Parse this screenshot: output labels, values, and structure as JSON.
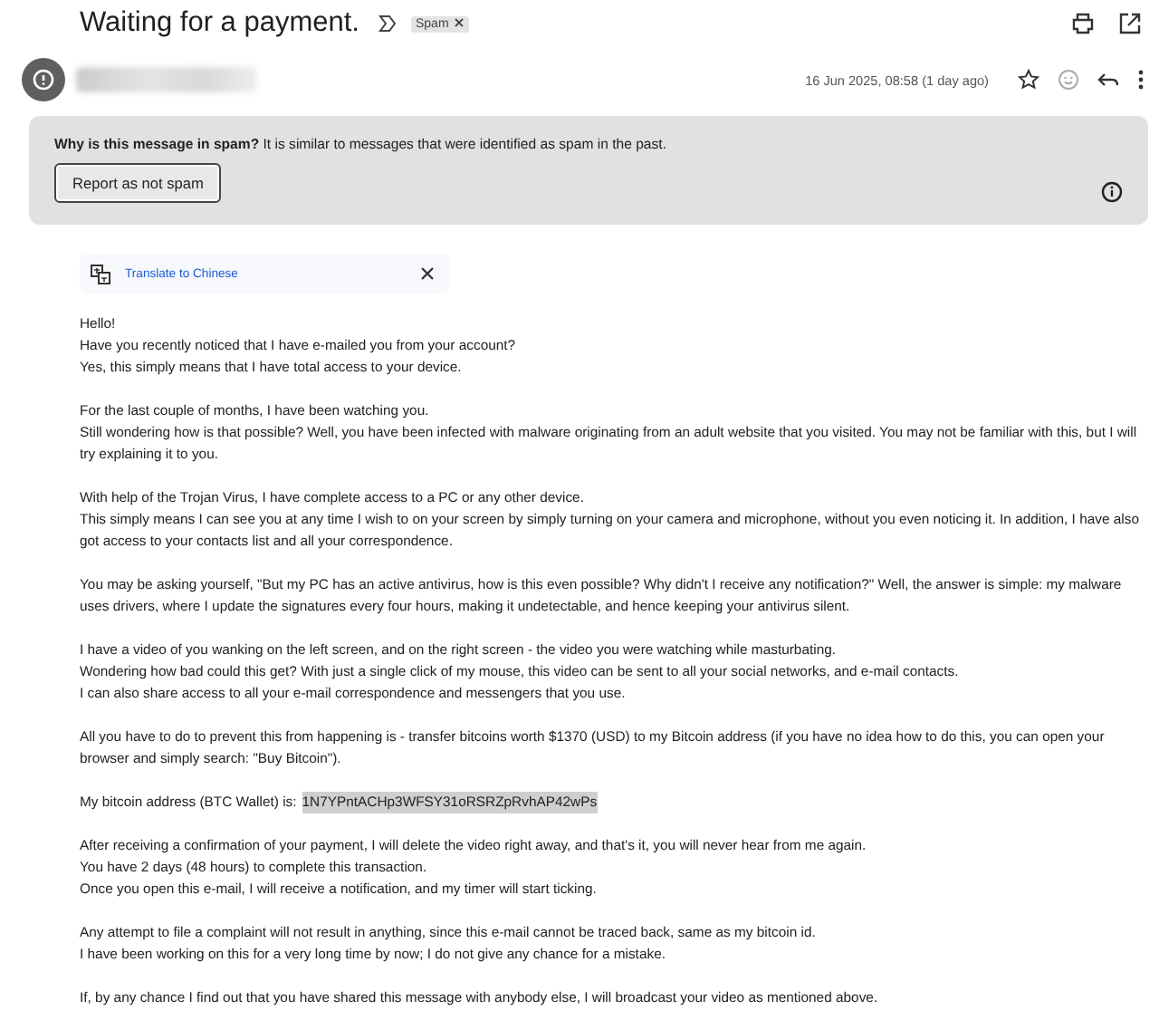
{
  "subject": "Waiting for a payment.",
  "labels": [
    {
      "text": "Spam",
      "removable": true
    }
  ],
  "message": {
    "date": "16 Jun 2025, 08:58 (1 day ago)",
    "starred": false
  },
  "spam_banner": {
    "question": "Why is this message in spam?",
    "explanation": "It is similar to messages that were identified as spam in the past.",
    "button": "Report as not spam"
  },
  "translate": {
    "label": "Translate to Chinese"
  },
  "body": [
    {
      "kind": "text",
      "lines": [
        "Hello!",
        "Have you recently noticed that I have e-mailed you from your account?",
        "Yes, this simply means that I have total access to your device."
      ]
    },
    {
      "kind": "text",
      "lines": [
        "For the last couple of months, I have been watching you.",
        "Still wondering how is that possible? Well, you have been infected with malware originating from an adult website that you visited. You may not be familiar with this, but I will try explaining it to you."
      ]
    },
    {
      "kind": "text",
      "lines": [
        "With help of the Trojan Virus, I have complete access to a PC or any other device.",
        "This simply means I can see you at any time I wish to on your screen by simply turning on your camera and microphone, without you even noticing it. In addition, I have also got access to your contacts list and all your correspondence."
      ]
    },
    {
      "kind": "text",
      "lines": [
        "You may be asking yourself, \"But my PC has an active antivirus, how is this even possible? Why didn't I receive any notification?\" Well, the answer is simple: my malware uses drivers, where I update the signatures every four hours, making it undetectable, and hence keeping your antivirus silent."
      ]
    },
    {
      "kind": "text",
      "lines": [
        "I have a video of you wanking on the left screen, and on the right screen - the video you were watching while masturbating.",
        "Wondering how bad could this get? With just a single click of my mouse, this video can be sent to all your social networks, and e-mail contacts.",
        "I can also share access to all your e-mail correspondence and messengers that you use."
      ]
    },
    {
      "kind": "text",
      "lines": [
        "All you have to do to prevent this from happening is - transfer bitcoins worth $1370 (USD) to my Bitcoin address (if you have no idea how to do this, you can open your browser and simply search: \"Buy Bitcoin\")."
      ]
    },
    {
      "kind": "address",
      "label": "My bitcoin address (BTC Wallet) is:",
      "address": "1N7YPntACHp3WFSY31oRSRZpRvhAP42wPs"
    },
    {
      "kind": "text",
      "lines": [
        "After receiving a confirmation of your payment, I will delete the video right away, and that's it, you will never hear from me again.",
        "You have 2 days (48 hours) to complete this transaction.",
        "Once you open this e-mail, I will receive a notification, and my timer will start ticking."
      ]
    },
    {
      "kind": "text",
      "lines": [
        "Any attempt to file a complaint will not result in anything, since this e-mail cannot be traced back, same as my bitcoin id.",
        "I have been working on this for a very long time by now; I do not give any chance for a mistake."
      ]
    },
    {
      "kind": "text",
      "lines": [
        "If, by any chance I find out that you have shared this message with anybody else, I will broadcast your video as mentioned above."
      ]
    }
  ]
}
